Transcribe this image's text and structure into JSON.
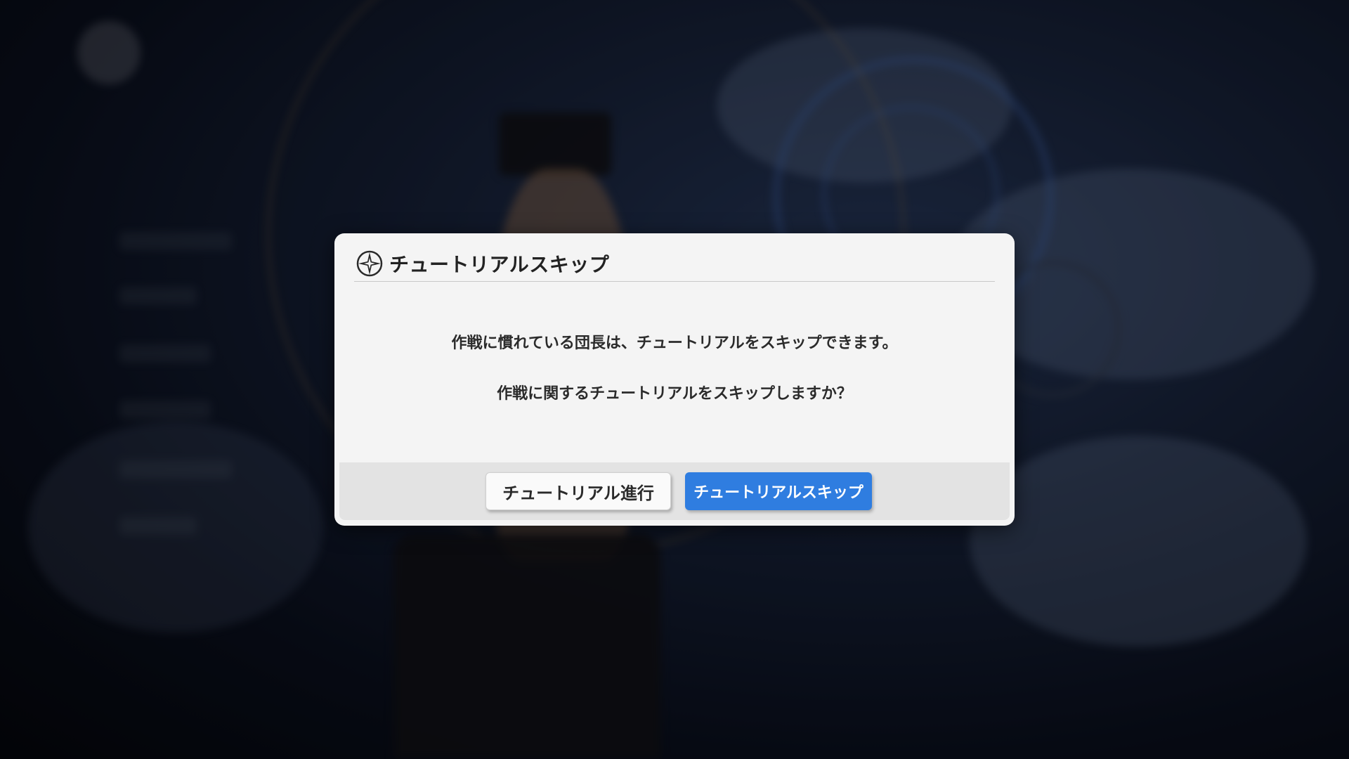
{
  "dialog": {
    "title": "チュートリアルスキップ",
    "icon": "compass-star-icon",
    "message_line1": "作戦に慣れている団長は、チュートリアルをスキップできます。",
    "message_line2": "作戦に関するチュートリアルをスキップしますか？",
    "proceed_button_label": "チュートリアル進行",
    "skip_button_label": "チュートリアルスキップ"
  },
  "colors": {
    "skip_button": "#2f7de0",
    "dialog_background": "#f4f4f4",
    "footer_background": "#e3e3e3"
  }
}
